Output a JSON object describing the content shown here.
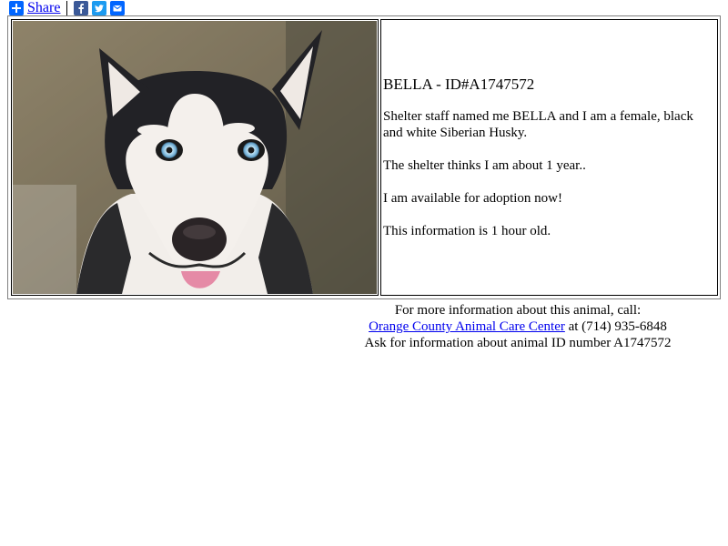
{
  "share": {
    "label": "Share",
    "buttons": [
      "facebook-icon",
      "twitter-icon",
      "email-icon"
    ],
    "colors": {
      "share": "#0166ff",
      "facebook": "#3b5998",
      "twitter": "#1d9bf0",
      "email": "#0166ff"
    }
  },
  "animal": {
    "title": "BELLA - ID#A1747572",
    "description": "Shelter staff named me BELLA and I am a female, black and white Siberian Husky.",
    "age": "The shelter thinks I am about 1 year..",
    "availability": "I am available for adoption now!",
    "freshness": "This information is 1 hour old.",
    "photo_icon": "husky-photo"
  },
  "contact": {
    "intro": "For more information about this animal, call:",
    "center_name": "Orange County Animal Care Center",
    "phone_text": " at (714) 935-6848",
    "ask_text": "Ask for information about animal ID number A1747572"
  },
  "colors": {
    "link": "#0000ee",
    "text": "#000000"
  }
}
